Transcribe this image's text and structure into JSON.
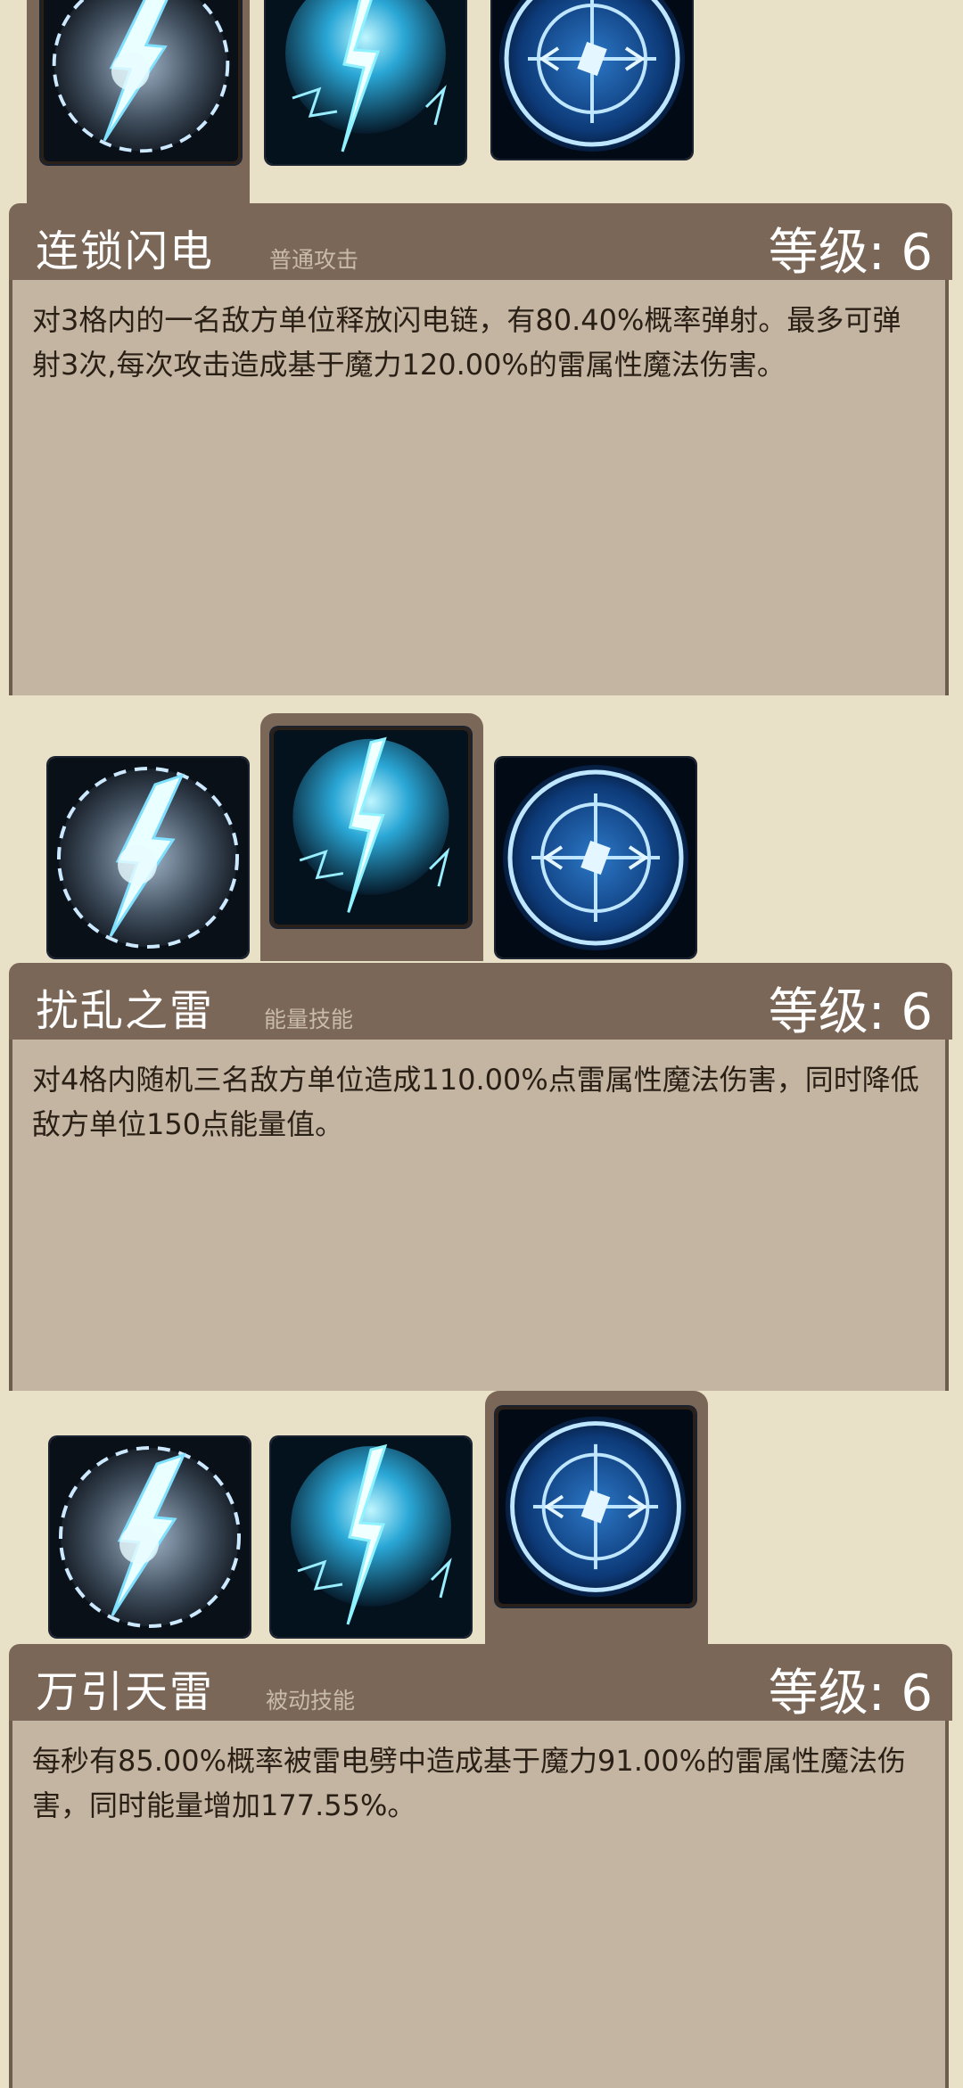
{
  "skills": [
    {
      "name": "连锁闪电",
      "type": "普通攻击",
      "level": "等级: 6",
      "description": "对3格内的一名敌方单位释放闪电链，有80.40%概率弹射。最多可弹射3次,每次攻击造成基于魔力120.00%的雷属性魔法伤害。"
    },
    {
      "name": "扰乱之雷",
      "type": "能量技能",
      "level": "等级: 6",
      "description": "对4格内随机三名敌方单位造成110.00%点雷属性魔法伤害，同时降低敌方单位150点能量值。"
    },
    {
      "name": "万引天雷",
      "type": "被动技能",
      "level": "等级: 6",
      "description": "每秒有85.00%概率被雷电劈中造成基于魔力91.00%的雷属性魔法伤害，同时能量增加177.55%。"
    }
  ],
  "icons": [
    "chain-lightning-icon",
    "disrupting-thunder-icon",
    "heavenly-thunder-icon"
  ],
  "colors": {
    "header": "#7b6757",
    "body": "#c3b5a2",
    "page": "#e9e0c8",
    "text": "#2a1f15"
  }
}
